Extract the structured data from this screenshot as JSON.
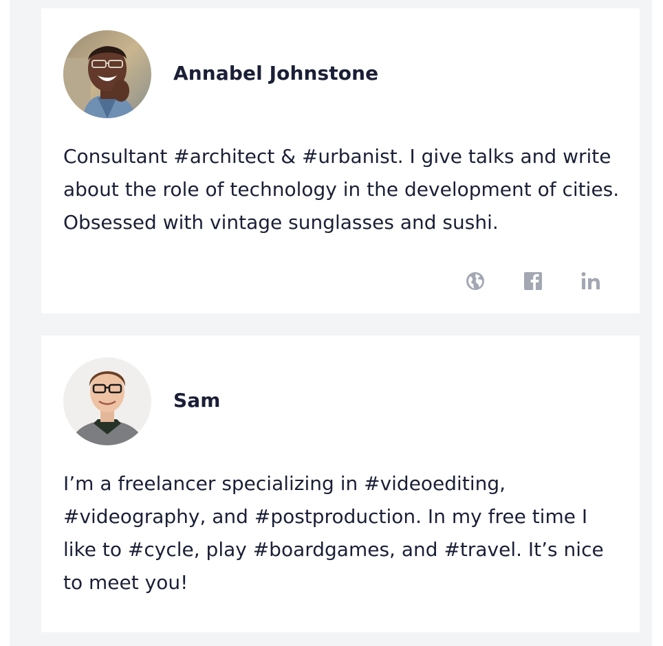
{
  "colors": {
    "page_background": "#ffffff",
    "panel_background": "#f3f4f6",
    "card_background": "#ffffff",
    "text": "#1a1f36",
    "icon": "#a3a7b2"
  },
  "profiles": [
    {
      "name": "Annabel Johnstone",
      "bio": "Consultant #architect & #urbanist. I give talks and write about the role of technology in the development of cities. Obsessed with vintage sunglasses and sushi.",
      "social_links": [
        {
          "icon": "globe-icon"
        },
        {
          "icon": "facebook-icon"
        },
        {
          "icon": "linkedin-icon"
        }
      ]
    },
    {
      "name": "Sam",
      "bio": "I’m a freelancer specializing in #videoediting, #videography, and #postproduction. In my free time I like to #cycle, play #boardgames, and #travel. It’s nice to meet you!"
    }
  ]
}
